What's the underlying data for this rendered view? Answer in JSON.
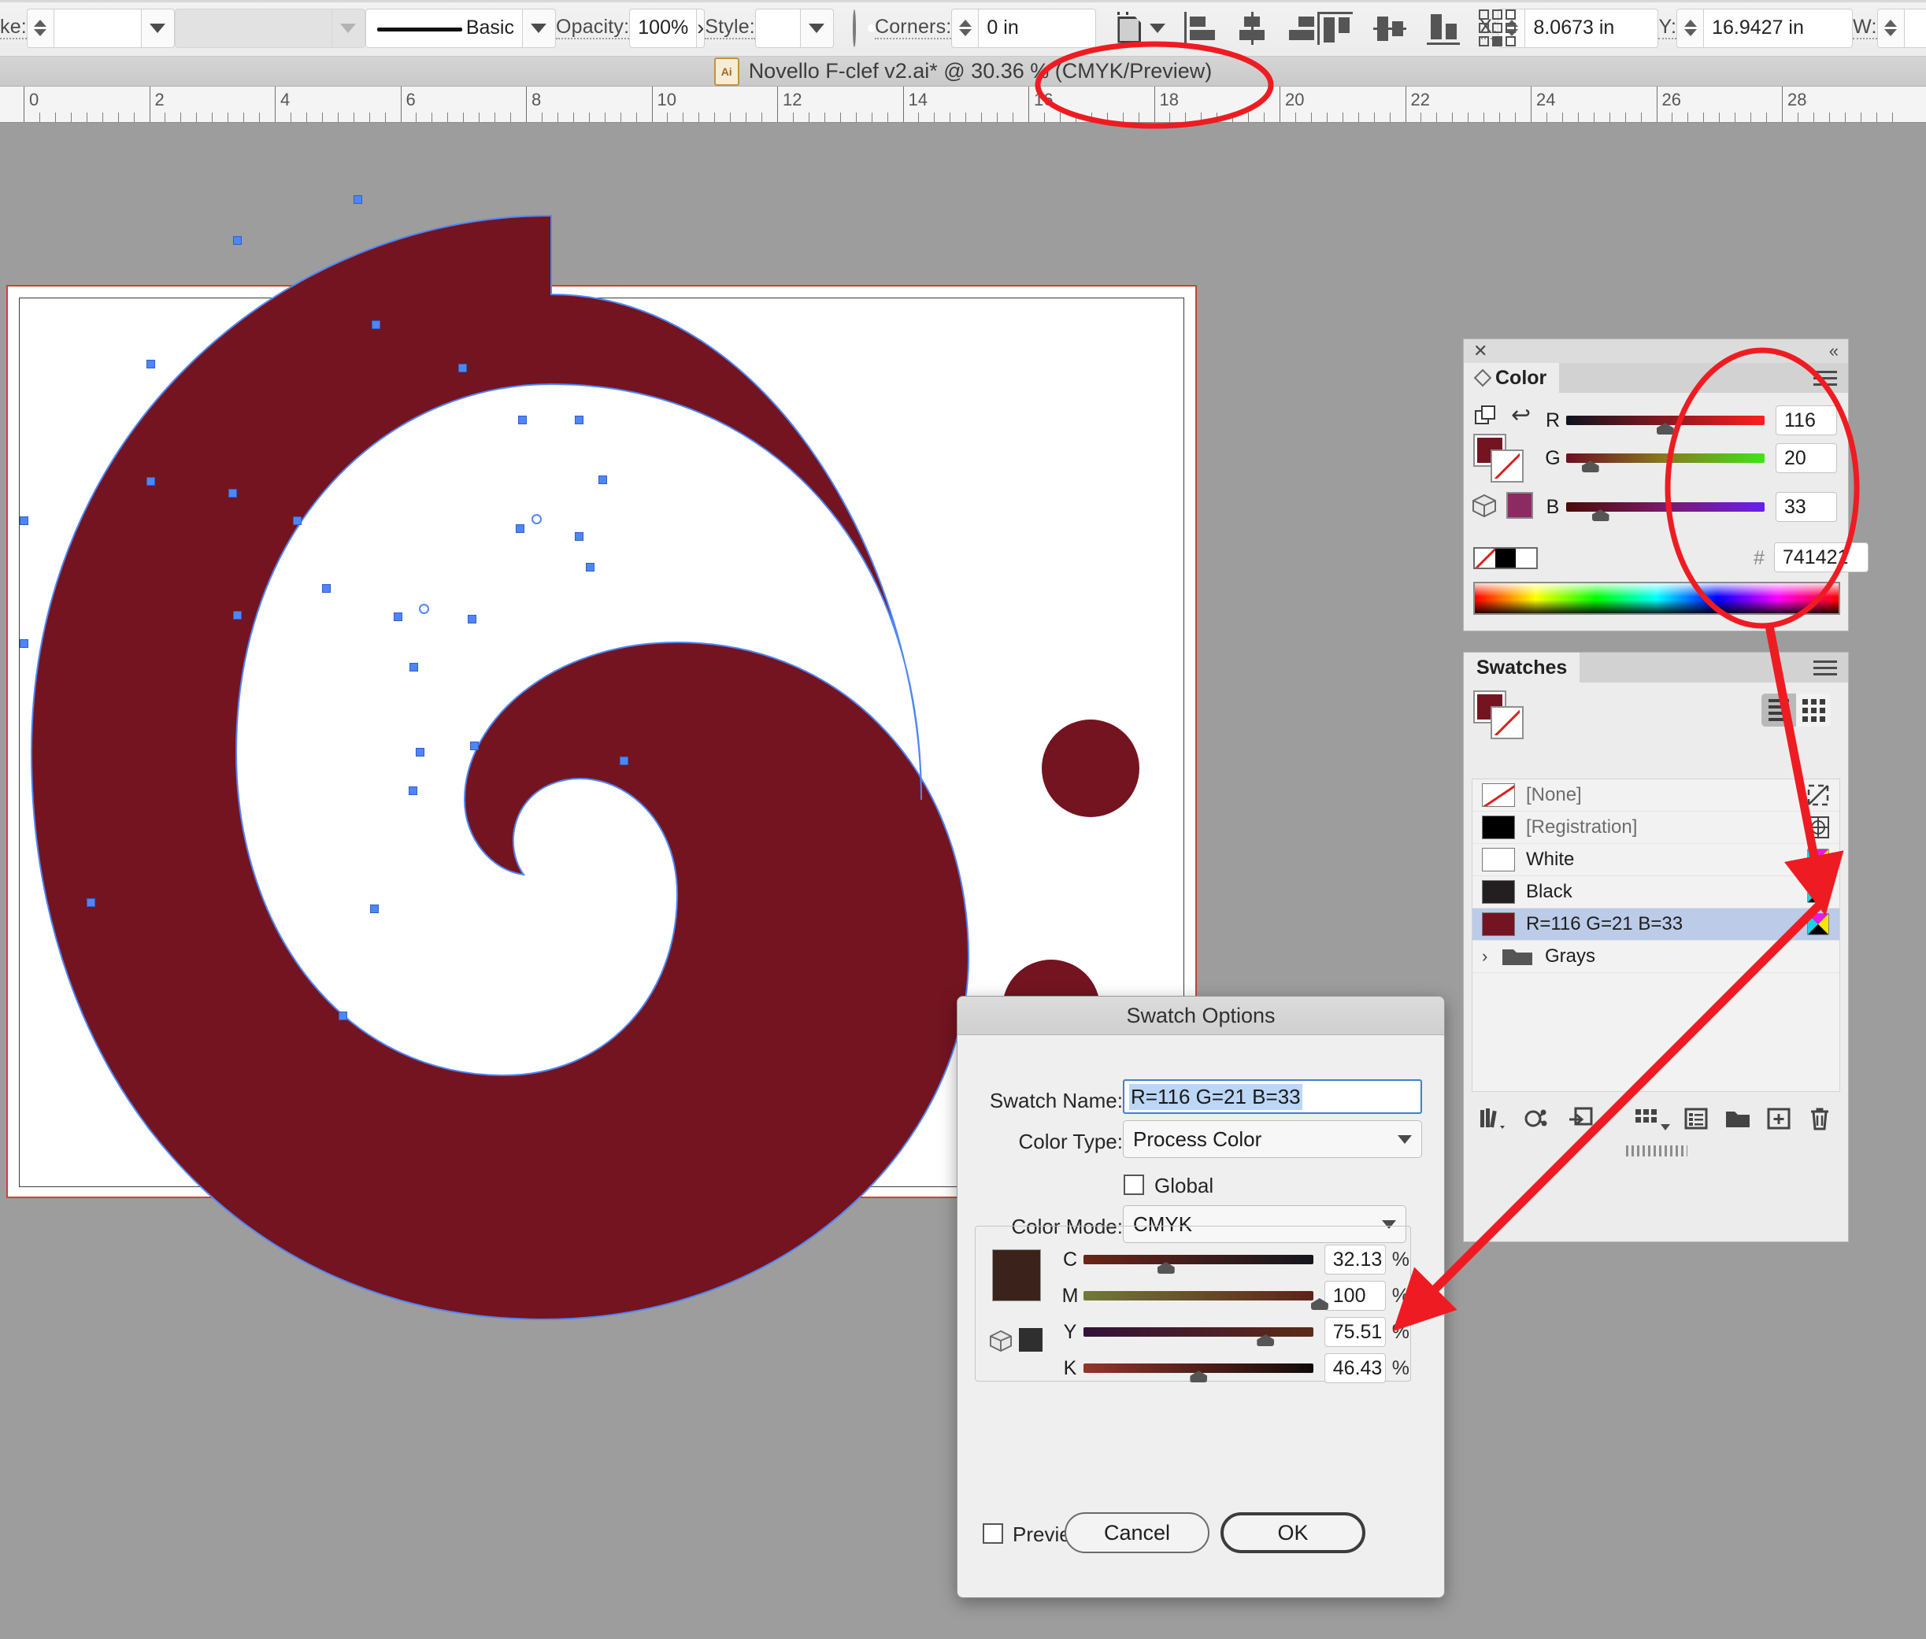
{
  "app": {
    "title_bar": {
      "document_title": "Novello F-clef v2.ai* @ 30.36 % (CMYK/Preview)",
      "app_icon": "illustrator-ai-icon"
    }
  },
  "control_bar": {
    "stroke_label": "ke:",
    "stroke_weight_value": "",
    "profile_value": "",
    "brush_label": "Basic",
    "opacity_label": "Opacity:",
    "opacity_value": "100%",
    "opacity_arrow": "›",
    "style_label": "Style:",
    "style_value": "",
    "corners_label": "Corners:",
    "corners_value": "0 in",
    "x_label": "X:",
    "x_value": "8.0673 in",
    "y_label": "Y:",
    "y_value": "16.9427 in",
    "w_label": "W:",
    "w_value": ""
  },
  "ruler": {
    "unit": "in",
    "labels": [
      "0",
      "2",
      "4",
      "6",
      "8",
      "10",
      "12",
      "14",
      "16",
      "18",
      "20",
      "22",
      "24",
      "26",
      "28"
    ]
  },
  "color_panel": {
    "tab_label": "Color",
    "menu_icon": "hamburger-menu-icon",
    "close_icon": "close-icon",
    "collapse_icon": "collapse-panel-icon",
    "mode": "RGB",
    "channels": [
      {
        "label": "R",
        "value": "116",
        "pct": 45.5
      },
      {
        "label": "G",
        "value": "20",
        "pct": 7.8
      },
      {
        "label": "B",
        "value": "33",
        "pct": 12.9
      }
    ],
    "hex_symbol": "#",
    "hex_value": "741421",
    "fill_color": "#741421",
    "stroke_color": "none",
    "out_of_gamut_color": "#8c2a63"
  },
  "swatches_panel": {
    "tab_label": "Swatches",
    "menu_icon": "hamburger-menu-icon",
    "view_list_icon": "list-view-icon",
    "view_grid_icon": "grid-view-icon",
    "rows": [
      {
        "name": "[None]",
        "chip": "none",
        "dim": true,
        "right_icon": "none-icon",
        "selected": false
      },
      {
        "name": "[Registration]",
        "chip": "#000000",
        "dim": true,
        "right_icon": "registration-icon",
        "selected": false
      },
      {
        "name": "White",
        "chip": "#ffffff",
        "dim": false,
        "right_icon": "cmyk-icon",
        "selected": false
      },
      {
        "name": "Black",
        "chip": "#231f20",
        "dim": false,
        "right_icon": "cmyk-icon",
        "selected": false
      },
      {
        "name": "R=116 G=21 B=33",
        "chip": "#741421",
        "dim": false,
        "right_icon": "cmyk-icon",
        "selected": true
      },
      {
        "name": "Grays",
        "chip": "folder",
        "dim": false,
        "right_icon": "",
        "selected": false
      }
    ],
    "footer_icons": [
      "swatch-libraries-icon",
      "show-color-group-icon",
      "add-to-library-icon",
      "swatch-kinds-icon",
      "swatch-options-icon",
      "new-color-group-icon",
      "new-swatch-icon",
      "delete-swatch-icon"
    ]
  },
  "dialog": {
    "title": "Swatch Options",
    "swatch_name_label": "Swatch Name:",
    "swatch_name_value": "R=116 G=21 B=33",
    "color_type_label": "Color Type:",
    "color_type_value": "Process Color",
    "global_label": "Global",
    "global_checked": false,
    "color_mode_label": "Color Mode:",
    "color_mode_value": "CMYK",
    "preview_color": "#3b231c",
    "out_of_gamut_color": "#2f2f2f",
    "sliders": [
      {
        "label": "C",
        "value": "32.13",
        "unit": "%",
        "pct": 32.13,
        "from": "#6b2418",
        "to": "#14161e"
      },
      {
        "label": "M",
        "value": "100",
        "unit": "%",
        "pct": 100,
        "from": "#707a38",
        "to": "#5e2119"
      },
      {
        "label": "Y",
        "value": "75.51",
        "unit": "%",
        "pct": 75.51,
        "from": "#33113a",
        "to": "#5e2b17"
      },
      {
        "label": "K",
        "value": "46.43",
        "unit": "%",
        "pct": 46.43,
        "from": "#92352c",
        "to": "#110a08"
      }
    ],
    "preview_label": "Preview",
    "preview_checked": false,
    "cancel_label": "Cancel",
    "ok_label": "OK"
  },
  "artwork": {
    "description": "F-clef spiral in dark red with two dots",
    "fill_color": "#741421",
    "path_color": "#4f86f7",
    "artboard_border_color": "#d04038"
  },
  "annotations": {
    "color": "#ee1c22",
    "items": [
      {
        "kind": "ellipse",
        "target": "title-zoom-percentage"
      },
      {
        "kind": "ellipse",
        "target": "color-panel-rgb-values"
      },
      {
        "kind": "arrow",
        "target": "swatch-cmyk-indicator"
      },
      {
        "kind": "arrow",
        "target": "dialog-magenta-value"
      }
    ]
  }
}
